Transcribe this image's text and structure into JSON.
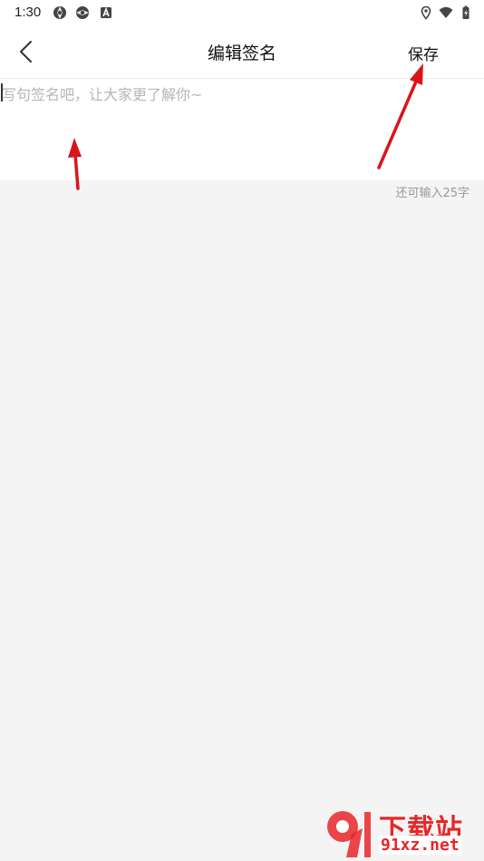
{
  "status_bar": {
    "time": "1:30",
    "icons": [
      "aperture-icon",
      "aperture-icon",
      "font-a-icon",
      "location-icon",
      "wifi-icon",
      "battery-charging-icon"
    ]
  },
  "header": {
    "back_icon": "chevron-left-icon",
    "title": "编辑签名",
    "save_label": "保存"
  },
  "signature": {
    "value": "",
    "placeholder": "写句签名吧，让大家更了解你~",
    "counter_text": "还可输入25字"
  },
  "annotations": {
    "color": "#d9141b"
  },
  "watermark": {
    "logo_mark": "9",
    "brand_text": "下载站",
    "site_text": "91xz.net",
    "color": "#e8262a"
  },
  "colors": {
    "background": "#f4f4f4",
    "surface": "#ffffff",
    "text": "#111111",
    "placeholder": "#b5b5b5",
    "counter": "#999999"
  }
}
